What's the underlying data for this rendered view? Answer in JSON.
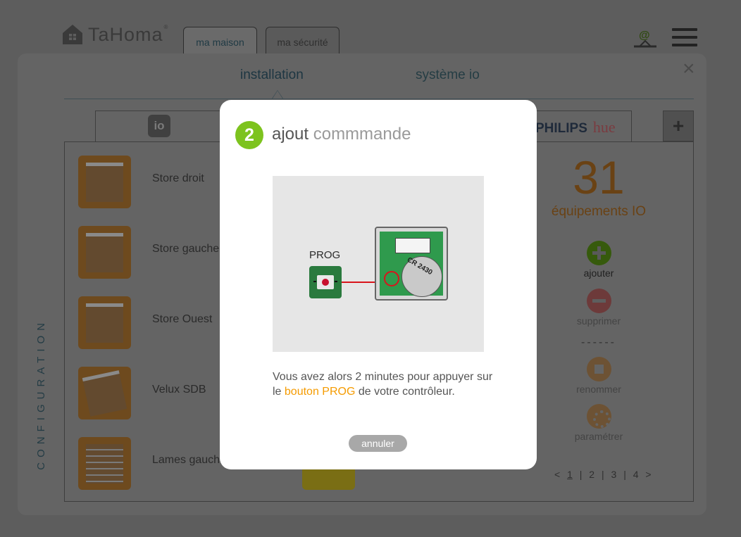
{
  "header": {
    "logo_text": "TaHoma",
    "logo_mark": "®",
    "tabs": [
      "ma maison",
      "ma sécurité"
    ],
    "account_icon": "user-at-icon",
    "menu_icon": "hamburger-icon"
  },
  "config": {
    "close_label": "×",
    "subtabs": [
      "installation",
      "système io"
    ],
    "io_tab_label": "io",
    "philips_label": "PHILIPS",
    "hue_label": "hue",
    "add_tab_label": "+",
    "vertical_label": "CONFIGURATION",
    "devices": [
      {
        "name": "Store droit",
        "icon": "blind-icon"
      },
      {
        "name": "Store gauche",
        "icon": "blind-icon"
      },
      {
        "name": "Store Ouest",
        "icon": "blind-icon"
      },
      {
        "name": "Velux SDB",
        "icon": "roof-window-icon"
      },
      {
        "name": "Lames gauche",
        "icon": "louvre-icon"
      }
    ],
    "counter_value": "31",
    "counter_label": "équipements IO",
    "actions": {
      "add": "ajouter",
      "delete": "supprimer",
      "separator": "------",
      "rename": "renommer",
      "configure": "paramétrer"
    },
    "pager": {
      "prev": "<",
      "pages": [
        "1",
        "2",
        "3",
        "4"
      ],
      "separator": "|",
      "next": ">",
      "current": "1"
    }
  },
  "modal": {
    "step": "2",
    "title_main": "ajout",
    "title_sub": "commmande",
    "illustration": {
      "prog_label": "PROG",
      "battery_label": "CR 2430"
    },
    "text_before": "Vous avez alors 2 minutes pour appuyer sur le ",
    "text_highlight": "bouton PROG",
    "text_after": " de votre contrôleur.",
    "cancel_label": "annuler"
  },
  "colors": {
    "accent_green": "#7dc31e",
    "highlight_orange": "#f59b00",
    "device_orange": "#e07a10"
  }
}
